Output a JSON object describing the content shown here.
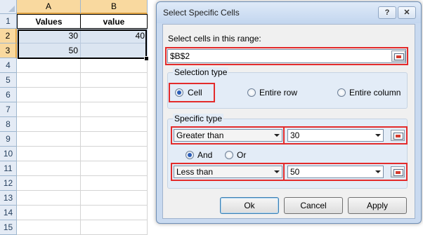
{
  "sheet": {
    "columns": [
      "A",
      "B"
    ],
    "rows": [
      "1",
      "2",
      "3",
      "4",
      "5",
      "6",
      "7",
      "8",
      "9",
      "10",
      "11",
      "12",
      "13",
      "14",
      "15"
    ],
    "cells": {
      "a1": "Values",
      "b1": "value",
      "a2": "30",
      "b2": "40",
      "a3": "50",
      "b3": ""
    }
  },
  "dialog": {
    "title": "Select Specific Cells",
    "help_label": "?",
    "close_label": "✕",
    "range_label": "Select cells in this range:",
    "range_value": "$B$2",
    "selection_type": {
      "label": "Selection type",
      "options": [
        "Cell",
        "Entire row",
        "Entire column"
      ],
      "selected": "Cell"
    },
    "specific_type": {
      "label": "Specific type",
      "cond1": {
        "operator": "Greater than",
        "value": "30"
      },
      "logic": {
        "options": [
          "And",
          "Or"
        ],
        "selected": "And"
      },
      "cond2": {
        "operator": "Less than",
        "value": "50"
      }
    },
    "buttons": {
      "ok": "Ok",
      "cancel": "Cancel",
      "apply": "Apply"
    }
  },
  "colors": {
    "highlight": "#e32b2b",
    "selection_fill": "#dbe5f1",
    "dialog_frame": "#c9daf0"
  }
}
